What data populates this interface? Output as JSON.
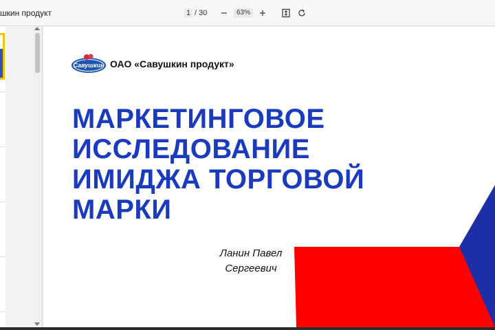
{
  "toolbar": {
    "doc_title": "шкин продукт",
    "current_page": "1",
    "page_total": "/ 30",
    "zoom": "63%",
    "icons": {
      "zoom_out": "minus-icon",
      "zoom_in": "plus-icon",
      "fit": "fit-page-icon",
      "rotate": "rotate-icon"
    }
  },
  "slide": {
    "logo_text": "Савушкин",
    "company": "ОАО «Савушкин продукт»",
    "title_lines": [
      "МАРКЕТИНГОВОЕ",
      "ИССЛЕДОВАНИЕ",
      "ИМИДЖА ТОРГОВОЙ",
      "МАРКИ"
    ],
    "author_lines": [
      "Ланин Павел",
      "Сергеевич"
    ]
  },
  "colors": {
    "title_blue": "#1b3bbd",
    "red": "#ff0000",
    "blue": "#1d2ea8",
    "thumb_highlight": "#f5c400"
  }
}
